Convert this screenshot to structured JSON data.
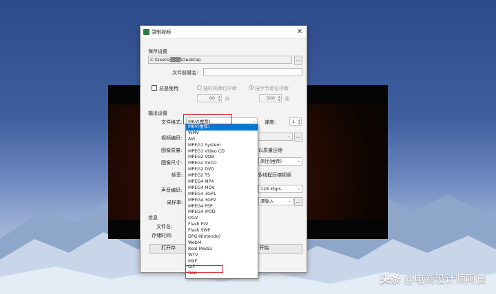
{
  "window": {
    "title": "录制视频",
    "close_glyph": "✕"
  },
  "save": {
    "section": "保存设置",
    "path": "C:\\Users\\▒▒▒\\Desktop",
    "browse": "...",
    "prefix_label": "文件前缀名:",
    "prefix_value": ""
  },
  "always": {
    "checkbox_label": "总是使用",
    "by_time_label": "按时间单位中断",
    "by_size_label": "按字节单位中断",
    "time_value": "60",
    "time_unit": "分",
    "size_value": "500",
    "size_unit": "兆"
  },
  "output": {
    "section": "输出设置",
    "format_label": "文件格式:",
    "format_value": "MKV(推荐)",
    "speed_label": "速度:",
    "speed_value": "1",
    "video_codec_label": "视频编码:",
    "quality_label": "图像质量:",
    "quality_right": "以质量压缩",
    "size_label": "图像尺寸:",
    "size_right": "原比(推荐)",
    "fps_label": "帧率:",
    "fps_right": "多线程压缩视频",
    "audio_codec_label": "声音编码:",
    "audio_bitrate": "128 kbps",
    "samplerate_label": "采样率:",
    "samplerate_right": "源输入",
    "extra_btn": "..."
  },
  "info": {
    "section": "信息",
    "filename_label": "文件名:",
    "storetime_label": "存储时间:",
    "open_btn": "打开存",
    "start_btn": "开始"
  },
  "format_options": [
    "MKV(推荐)",
    "WMV",
    "AVI",
    "MPEG1 System",
    "MPEG1 Video CD",
    "MPEG2 VOB",
    "MPEG2 SVCD",
    "MPEG2 DVD",
    "MPEG2 TS",
    "MPEG4 MP4",
    "MPEG4 MOV",
    "MPEG4 3GP1",
    "MPEG4 3GP2",
    "MPEG4 PSP",
    "MPEG4 IPOD",
    "OGV",
    "Flash FLV",
    "Flash SWF",
    "DPG(Nintendo)",
    "WebM",
    "Real Media",
    "WTV",
    "MXF",
    "GIF",
    "Raw"
  ],
  "watermark": {
    "brand": "头条",
    "handle": "@电商设计师阿贵"
  },
  "colors": {
    "selection": "#0078d7",
    "highlight_box": "#e0252c"
  }
}
